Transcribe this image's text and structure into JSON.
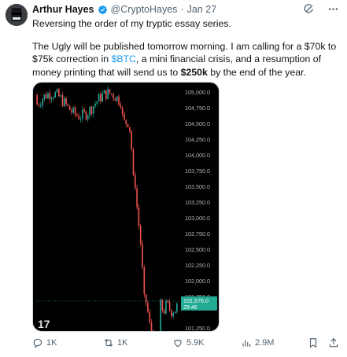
{
  "author": {
    "name": "Arthur Hayes",
    "handle": "@CryptoHayes",
    "separator": "·",
    "date": "Jan 27",
    "verified": true
  },
  "tweet": {
    "line1": "Reversing the order of my tryptic essay series.",
    "p2_part1": "The Ugly will be published tomorrow morning. I am calling for a $70k to $75k correction in ",
    "cashtag": "$BTC",
    "p2_part2": ", a mini financial crisis, and a resumption of money printing that will send us to ",
    "bold_amount": "$250k",
    "p2_part3": " by the end of the year."
  },
  "chart_data": {
    "type": "candlestick",
    "price_axis_labels": [
      "105,000.0",
      "104,750.0",
      "104,500.0",
      "104,250.0",
      "104,000.0",
      "103,750.0",
      "103,500.0",
      "103,250.0",
      "103,000.0",
      "102,750.0",
      "102,500.0",
      "102,250.0",
      "102,000.0",
      "101,750.0",
      "101,250.0"
    ],
    "ylim": [
      101200,
      105150
    ],
    "current_price_label": "101,676.0",
    "current_price_sub": "29:46",
    "current_price": 101676,
    "watermark": "17",
    "colors": {
      "up": "#26a69a",
      "down": "#ef5350",
      "background": "#000000",
      "price_tag": "#22ab94"
    }
  },
  "actions": {
    "replies": "1K",
    "reposts": "1K",
    "likes": "5.9K",
    "views": "2.9M"
  },
  "icons": [
    "grok-icon",
    "more-icon",
    "reply-icon",
    "repost-icon",
    "like-icon",
    "views-icon",
    "bookmark-icon",
    "share-icon"
  ]
}
